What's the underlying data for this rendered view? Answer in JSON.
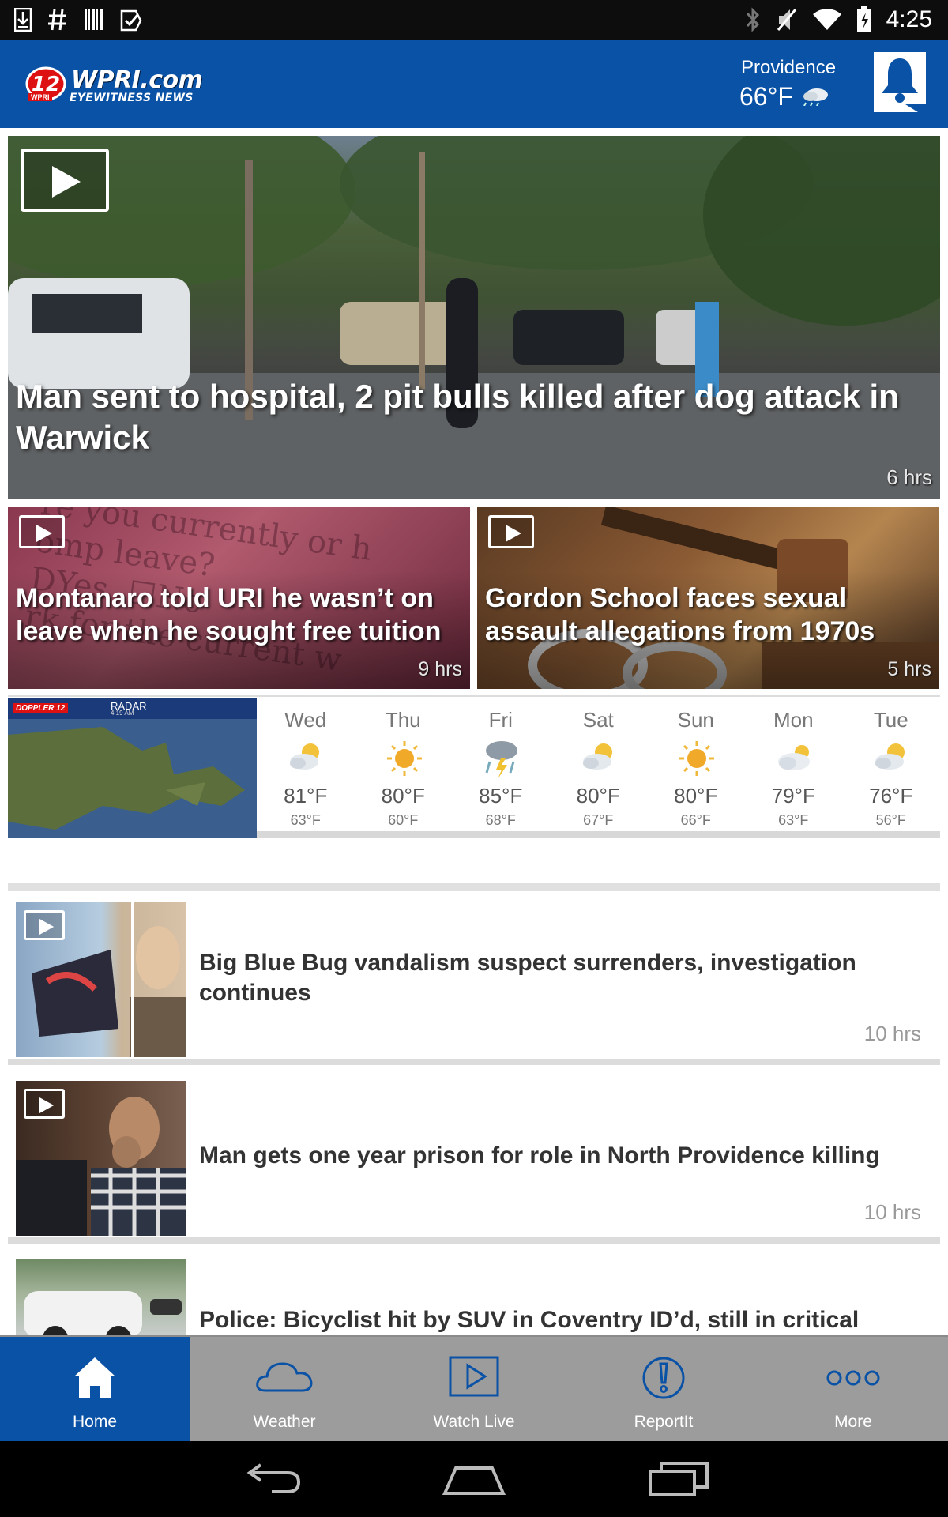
{
  "status_bar": {
    "time": "4:25",
    "left_icons": [
      "download-icon",
      "hash-icon",
      "barcode-icon",
      "check-icon"
    ],
    "right_icons": [
      "bluetooth-icon",
      "mute-icon",
      "wifi-icon",
      "battery-icon"
    ]
  },
  "header": {
    "logo_number": "12",
    "logo_main": "WPRI.com",
    "logo_sub": "EYEWITNESS NEWS",
    "logo_tag": "WPRI",
    "city": "Providence",
    "temperature": "66°F",
    "accent_color": "#0a52a6"
  },
  "hero": {
    "title": "Man sent to hospital, 2 pit bulls killed after dog attack in Warwick",
    "time": "6 hrs",
    "has_video": true
  },
  "cards": [
    {
      "title": "Montanaro told URI he wasn’t on leave when he sought free tuition",
      "time": "9 hrs",
      "bg_text": "re you currently or h\nomp leave?\nDYes  ☐No\nrk for the current w"
    },
    {
      "title": "Gordon School faces sexual assault allegations from 1970s",
      "time": "5 hrs"
    }
  ],
  "weather": {
    "radar_label": "RADAR",
    "radar_sub": "4:19 AM",
    "radar_brand": "DOPPLER 12",
    "forecast": [
      {
        "day": "Wed",
        "hi": "81°F",
        "lo": "63°F",
        "icon": "partly-cloudy-icon"
      },
      {
        "day": "Thu",
        "hi": "80°F",
        "lo": "60°F",
        "icon": "sunny-icon"
      },
      {
        "day": "Fri",
        "hi": "85°F",
        "lo": "68°F",
        "icon": "thunderstorm-icon"
      },
      {
        "day": "Sat",
        "hi": "80°F",
        "lo": "67°F",
        "icon": "partly-cloudy-icon"
      },
      {
        "day": "Sun",
        "hi": "80°F",
        "lo": "66°F",
        "icon": "sunny-icon"
      },
      {
        "day": "Mon",
        "hi": "79°F",
        "lo": "63°F",
        "icon": "mostly-cloudy-icon"
      },
      {
        "day": "Tue",
        "hi": "76°F",
        "lo": "56°F",
        "icon": "partly-cloudy-icon"
      }
    ]
  },
  "stories": [
    {
      "title": "Big Blue Bug vandalism suspect surrenders, investigation continues",
      "time": "10 hrs",
      "has_video": true
    },
    {
      "title": "Man gets one year prison for role in North Providence killing",
      "time": "10 hrs",
      "has_video": true
    },
    {
      "title": "Police: Bicyclist hit by SUV in Coventry ID’d, still in critical",
      "time": "",
      "has_video": false
    }
  ],
  "bottom_nav": [
    {
      "label": "Home",
      "icon": "home-icon",
      "active": true
    },
    {
      "label": "Weather",
      "icon": "cloud-icon",
      "active": false
    },
    {
      "label": "Watch Live",
      "icon": "play-icon",
      "active": false
    },
    {
      "label": "ReportIt",
      "icon": "exclamation-icon",
      "active": false
    },
    {
      "label": "More",
      "icon": "more-icon",
      "active": false
    }
  ],
  "system_nav": [
    "back-icon",
    "home-outline-icon",
    "recents-icon"
  ]
}
